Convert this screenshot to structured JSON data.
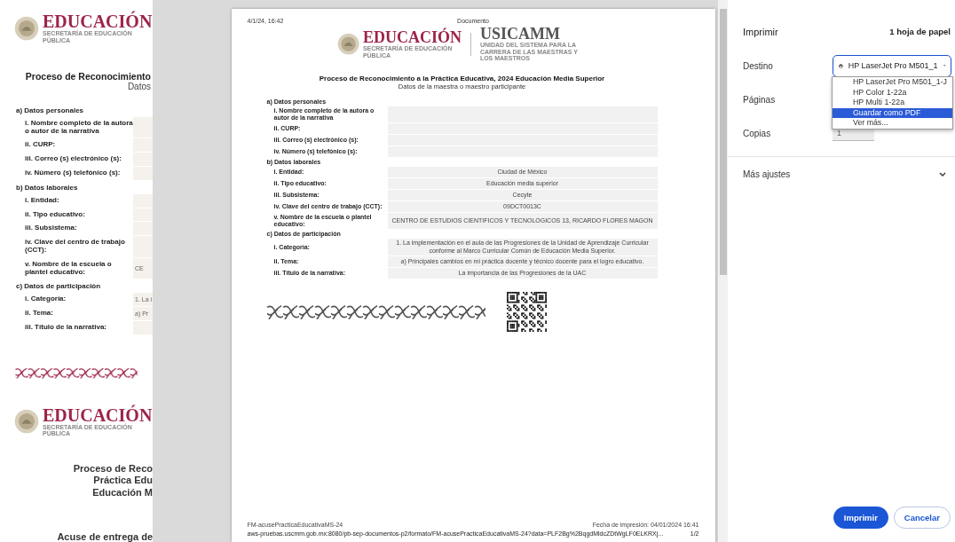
{
  "background_page": {
    "logo": {
      "title": "EDUCACIÓN",
      "subtitle": "SECRETARÍA DE EDUCACIÓN PÚBLICA"
    },
    "title": "Proceso de Reconocimiento",
    "subtitle": "Datos",
    "sections": [
      {
        "heading": "a) Datos personales",
        "rows": [
          {
            "label": "i. Nombre completo de la autora o autor de la narrativa"
          },
          {
            "label": "ii. CURP:"
          },
          {
            "label": "iii. Correo (s) electrónico (s):"
          },
          {
            "label": "iv. Número (s) telefónico (s):"
          }
        ]
      },
      {
        "heading": "b) Datos laborales",
        "rows": [
          {
            "label": "i. Entidad:"
          },
          {
            "label": "ii. Tipo educativo:"
          },
          {
            "label": "iii. Subsistema:"
          },
          {
            "label": "iv. Clave del centro de trabajo (CCT):"
          },
          {
            "label": "v. Nombre de la escuela o plantel educativo:",
            "value": "CE"
          }
        ]
      },
      {
        "heading": "c) Datos de participación",
        "rows": [
          {
            "label": "i. Categoría:",
            "value": "1. La i"
          },
          {
            "label": "ii. Tema:",
            "value": "a) Pr"
          },
          {
            "label": "iii. Título de la narrativa:"
          }
        ]
      }
    ],
    "second_logo": {
      "title": "EDUCACIÓN",
      "subtitle": "SECRETARÍA DE EDUCACIÓN PÚBLICA"
    },
    "second_title_lines": [
      "Proceso de Reco",
      "Práctica Edu",
      "Educación M"
    ],
    "receipt": "Acuse de entrega de"
  },
  "preview": {
    "header_date": "4/1/24, 16:42",
    "header_title": "Documento",
    "logo": {
      "title": "EDUCACIÓN",
      "subtitle": "SECRETARÍA DE EDUCACIÓN PÚBLICA"
    },
    "second_logo": {
      "title": "USICAMM",
      "subtitle": "UNIDAD DEL SISTEMA PARA LA CARRERA DE LAS MAESTRAS Y LOS MAESTROS"
    },
    "title": "Proceso de Reconocimiento a la Práctica Educativa, 2024 Educación Media Superior",
    "subtitle": "Datos de la maestra o maestro participante",
    "sections": [
      {
        "heading": "a) Datos personales",
        "rows": [
          {
            "label": "i. Nombre completo de la autora o autor de la narrativa"
          },
          {
            "label": "ii. CURP:"
          },
          {
            "label": "iii. Correo (s) electrónico (s):"
          },
          {
            "label": "iv. Número (s) telefónico (s):"
          }
        ]
      },
      {
        "heading": "b) Datos laborales",
        "rows": [
          {
            "label": "i. Entidad:",
            "value": "Ciudad de México"
          },
          {
            "label": "ii. Tipo educativo:",
            "value": "Educación media superior"
          },
          {
            "label": "iii. Subsistema:",
            "value": "Cecyte"
          },
          {
            "label": "iv. Clave del centro de trabajo (CCT):",
            "value": "09DCT0013C"
          },
          {
            "label": "v. Nombre de la escuela o plantel educativo:",
            "value": "CENTRO DE ESTUDIOS CIENTIFICOS Y TECNOLOGICOS 13, RICARDO FLORES MAGON"
          }
        ]
      },
      {
        "heading": "c) Datos de participación",
        "rows": [
          {
            "label": "i. Categoría:",
            "value": "1. La implementación en el aula de las Progresiones de la Unidad de Aprendizaje Curricular conforme al Marco Curricular Común de Educación Media Superior."
          },
          {
            "label": "ii. Tema:",
            "value": "a) Principales cambios en mi práctica docente y técnico docente para el logro educativo."
          },
          {
            "label": "iii. Título de la narrativa:",
            "value": "La importancia de las Progresiones de la UAC"
          }
        ]
      }
    ],
    "footer_code": "FM-acusePracticaEducativaMS-24",
    "footer_date": "Fecha de impresión: 04/01/2024 16:41",
    "url": "aws-pruebas.uscmm.gob.mx:8080/pb-sep-documentos-p2/formato/FM-acusePracticaEducativaMS-24?data=PLF2Bg%2BqgdMldcZDtWgLF0ELKRXj...",
    "page_number": "1/2"
  },
  "settings": {
    "title": "Imprimir",
    "sheets": "1 hoja de papel",
    "destination": {
      "label": "Destino",
      "value": "HP LaserJet Pro M501_1",
      "options": [
        {
          "label": "HP LaserJet Pro M501_1-J",
          "selected": false
        },
        {
          "label": "HP Color 1-22a",
          "selected": false
        },
        {
          "label": "HP Multi 1-22a",
          "selected": false
        },
        {
          "label": "Guardar como PDF",
          "selected": true
        },
        {
          "label": "Ver más...",
          "selected": false
        }
      ]
    },
    "pages_label": "Páginas",
    "copies": {
      "label": "Copias",
      "value": "1"
    },
    "more": "Más ajustes",
    "buttons": [
      {
        "label": "Imprimir",
        "kind": "primary"
      },
      {
        "label": "Cancelar",
        "kind": "secondary"
      }
    ]
  }
}
